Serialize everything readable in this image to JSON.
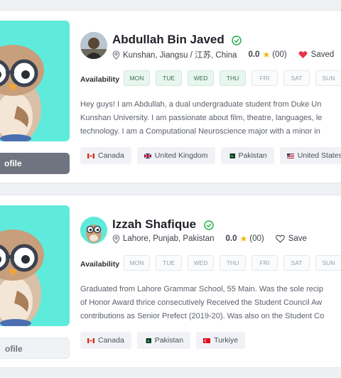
{
  "colors": {
    "accent_teal": "#5eebdc",
    "verified_green": "#22b14c",
    "heart_red": "#e8344a",
    "star_gold": "#f5b400"
  },
  "tutors": [
    {
      "name": "Abdullah Bin Javed",
      "verified_icon": "check-badge-icon",
      "location": "Kunshan, Jiangsu / 江苏, China",
      "rating": "0.0",
      "reviews": "(00)",
      "save_label": "Saved",
      "saved": true,
      "availability_label": "Availability",
      "days": [
        {
          "label": "MON",
          "available": true
        },
        {
          "label": "TUE",
          "available": true
        },
        {
          "label": "WED",
          "available": true
        },
        {
          "label": "THU",
          "available": true
        },
        {
          "label": "FRI",
          "available": false
        },
        {
          "label": "SAT",
          "available": false
        },
        {
          "label": "SUN",
          "available": false
        }
      ],
      "bio_lines": [
        "Hey guys! I am Abdullah, a dual undergraduate student from Duke Un",
        "Kunshan University. I am passionate about film, theatre, languages, le",
        "technology. I am a Computational Neuroscience major with a minor in"
      ],
      "languages": [
        "Canada",
        "United Kingdom",
        "Pakistan",
        "United States"
      ],
      "profile_button": "ofile"
    },
    {
      "name": "Izzah Shafique",
      "verified_icon": "check-badge-icon",
      "location": "Lahore, Punjab, Pakistan",
      "rating": "0.0",
      "reviews": "(00)",
      "save_label": "Save",
      "saved": false,
      "availability_label": "Availability",
      "days": [
        {
          "label": "MON",
          "available": false
        },
        {
          "label": "TUE",
          "available": false
        },
        {
          "label": "WED",
          "available": false
        },
        {
          "label": "THU",
          "available": false
        },
        {
          "label": "FRI",
          "available": false
        },
        {
          "label": "SAT",
          "available": false
        },
        {
          "label": "SUN",
          "available": false
        }
      ],
      "bio_lines": [
        "Graduated from Lahore Grammar School, 55 Main.  Was the sole recip",
        "of Honor Award thrice consecutively Received the Student Council Aw",
        "contributions as Senior Prefect (2019-20). Was also on the Student Co"
      ],
      "languages": [
        "Canada",
        "Pakistan",
        "Turkiye"
      ],
      "profile_button": "ofile"
    }
  ]
}
